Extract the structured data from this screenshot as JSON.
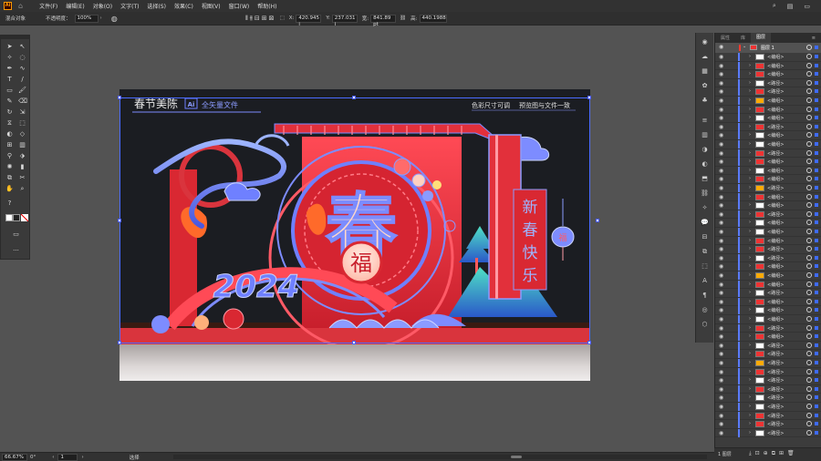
{
  "app": {
    "logo_text": "Ai"
  },
  "menubar": {
    "items": [
      "文件(F)",
      "编辑(E)",
      "对象(O)",
      "文字(T)",
      "选择(S)",
      "效果(C)",
      "视图(V)",
      "窗口(W)",
      "帮助(H)"
    ],
    "right_icons": [
      "search-icon",
      "layout-icon",
      "window-icon"
    ]
  },
  "controlbar": {
    "selection_label": "混合对象",
    "opacity_label": "不透明度：",
    "opacity_value": "100%",
    "x_label": "X:",
    "x_value": "420.945 i",
    "y_label": "Y:",
    "y_value": "237.031 i",
    "w_label": "宽:",
    "w_value": "841.89 pt",
    "h_label": "高:",
    "h_value": "440.1988"
  },
  "artwork": {
    "title": "春节美陈",
    "badge": "Ai",
    "subtitle": "全矢量文件",
    "note_left": "色彩尺寸可调",
    "note_right": "预览图与文件一致",
    "main_char": "春",
    "fu_char": "福",
    "year_text": "2024",
    "vertical_banner": [
      "新",
      "春",
      "快",
      "乐"
    ],
    "lantern_char": "福"
  },
  "colors": {
    "accent_red": "#e8303a",
    "stroke_blue": "#5a6cff",
    "highlight_pink": "#ff9db0",
    "dark_bg": "#1b1d22",
    "teal": "#2fb8a6"
  },
  "layers_panel": {
    "tabs": [
      "属性",
      "库",
      "图层"
    ],
    "active_tab": "图层",
    "top_layer": "图层 1",
    "rows": [
      "<编组>",
      "<编组>",
      "<编组>",
      "<路径>",
      "<路径>",
      "<编组>",
      "<编组>",
      "<编组>",
      "<路径>",
      "<编组>",
      "<编组>",
      "<路径>",
      "<编组>",
      "<编组>",
      "<编组>",
      "<路径>",
      "<编组>",
      "<编组>",
      "<路径>",
      "<编组>",
      "<编组>",
      "<编组>",
      "<路径>",
      "<路径>",
      "<编组>",
      "<编组>",
      "<编组>",
      "<路径>",
      "<编组>",
      "<编组>",
      "<编组>",
      "<路径>",
      "<编组>",
      "<路径>",
      "<路径>",
      "<路径>",
      "<路径>",
      "<路径>",
      "<路径>",
      "<路径>",
      "<路径>",
      "<路径>",
      "<路径>",
      "<路径>"
    ],
    "footer_label": "1 图层"
  },
  "statusbar": {
    "zoom": "66.67%",
    "rotation": "0°",
    "artboard_num": "1",
    "tool_name": "选择"
  }
}
